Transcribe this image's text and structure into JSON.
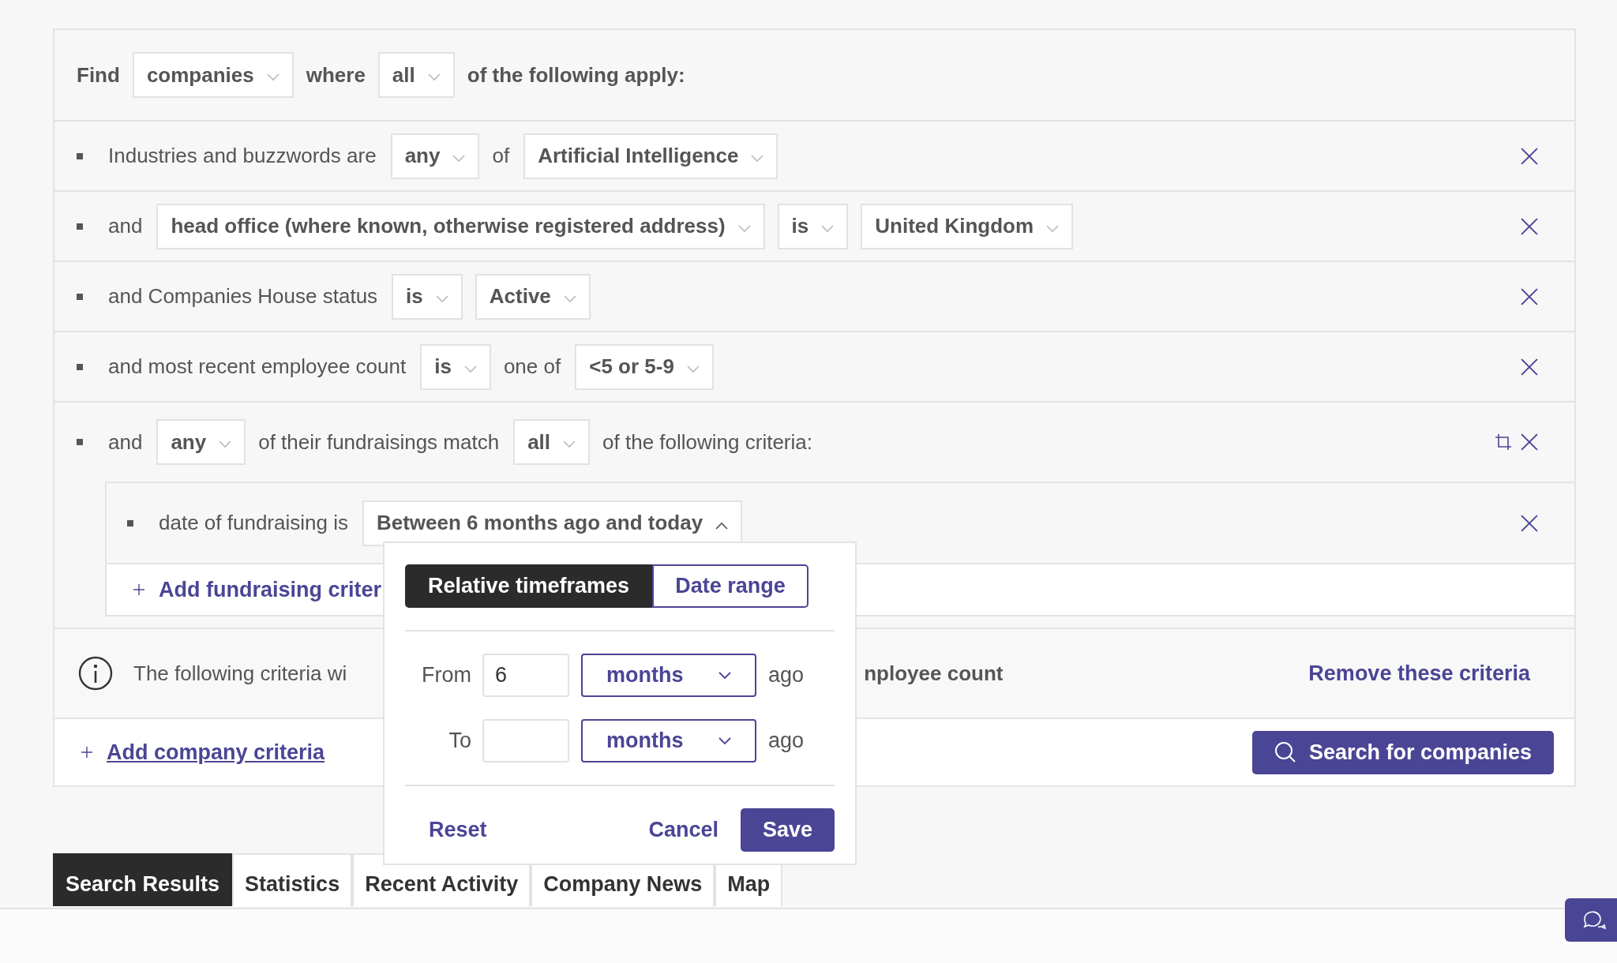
{
  "query": {
    "find_label": "Find",
    "subject": "companies",
    "where_label": "where",
    "match": "all",
    "suffix": "of the following apply:"
  },
  "criteria": [
    {
      "kind": "simple",
      "parts": [
        {
          "kind": "text",
          "text": "Industries and buzzwords are"
        },
        {
          "kind": "select",
          "value": "any",
          "expanded": false
        },
        {
          "kind": "text",
          "text": "of"
        },
        {
          "kind": "select",
          "value": "Artificial Intelligence",
          "expanded": false
        }
      ]
    },
    {
      "kind": "simple",
      "parts": [
        {
          "kind": "text",
          "text": "and"
        },
        {
          "kind": "select",
          "value": "head office (where known, otherwise registered address)",
          "expanded": false
        },
        {
          "kind": "select",
          "value": "is",
          "expanded": false
        },
        {
          "kind": "select",
          "value": "United Kingdom",
          "expanded": false
        }
      ]
    },
    {
      "kind": "simple",
      "parts": [
        {
          "kind": "text",
          "text": "and Companies House status"
        },
        {
          "kind": "select",
          "value": "is",
          "expanded": false
        },
        {
          "kind": "select",
          "value": "Active",
          "expanded": false
        }
      ]
    },
    {
      "kind": "simple",
      "parts": [
        {
          "kind": "text",
          "text": "and most recent employee count"
        },
        {
          "kind": "select",
          "value": "is",
          "expanded": false
        },
        {
          "kind": "text",
          "text": "one of"
        },
        {
          "kind": "select",
          "value": "<5 or 5-9",
          "expanded": false
        }
      ]
    },
    {
      "kind": "group",
      "parts": [
        {
          "kind": "text",
          "text": "and"
        },
        {
          "kind": "select",
          "value": "any",
          "expanded": false
        },
        {
          "kind": "text",
          "text": "of their fundraisings match"
        },
        {
          "kind": "select",
          "value": "all",
          "expanded": false
        },
        {
          "kind": "text",
          "text": "of the following criteria:"
        }
      ],
      "children": [
        {
          "parts": [
            {
              "kind": "text",
              "text": "date of fundraising is"
            },
            {
              "kind": "select",
              "value": "Between 6 months ago and today",
              "expanded": true
            }
          ]
        }
      ],
      "add_link": "Add fundraising criter"
    }
  ],
  "info": {
    "text_start": "The following criteria wi",
    "text_end": "nployee count",
    "remove_link": "Remove these criteria"
  },
  "add_company": "Add company criteria",
  "search_button": "Search for companies",
  "popup": {
    "tabs": [
      {
        "label": "Relative timeframes",
        "selected": true
      },
      {
        "label": "Date range",
        "selected": false
      }
    ],
    "rows": [
      {
        "label": "From",
        "value": "6",
        "unit": "months",
        "suffix": "ago"
      },
      {
        "label": "To",
        "unit": "months",
        "suffix": "ago"
      }
    ],
    "reset": "Reset",
    "cancel": "Cancel",
    "save": "Save"
  },
  "result_tabs": [
    {
      "label": "Search Results",
      "selected": true
    },
    {
      "label": "Statistics",
      "selected": false
    },
    {
      "label": "Recent Activity",
      "selected": false
    },
    {
      "label": "Company News",
      "selected": false
    },
    {
      "label": "Map",
      "selected": false
    }
  ]
}
